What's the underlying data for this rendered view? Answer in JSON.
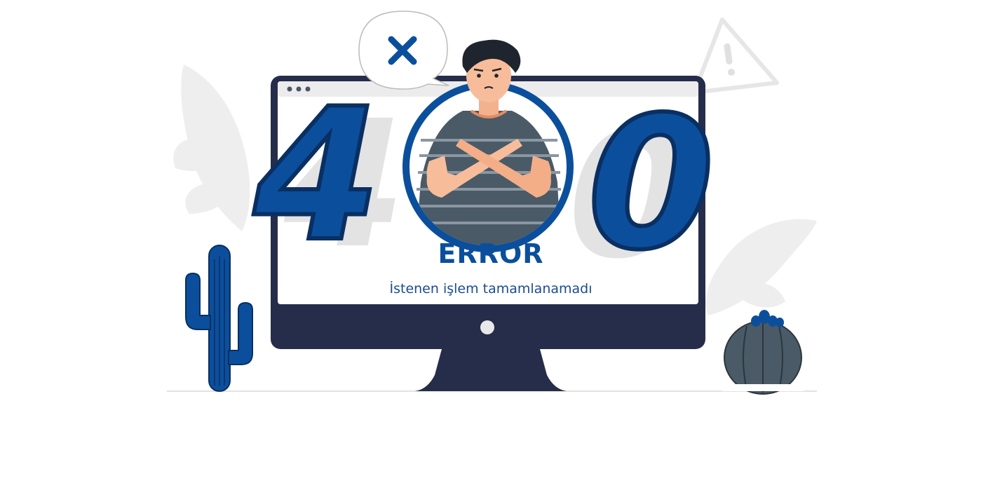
{
  "error": {
    "code_digits": [
      "4",
      "0",
      "0"
    ],
    "title": "ERROR",
    "message": "İstenen işlem tamamlanamadı"
  },
  "icons": {
    "speech": "close-x-icon",
    "warning": "warning-triangle-icon",
    "window_dots": "window-dots-icon"
  },
  "colors": {
    "brand_blue": "#0b4f9c",
    "dark_blue": "#0a2f62",
    "monitor_navy": "#252d4a",
    "shirt_gray": "#4a5a66",
    "light_gray": "#ececec"
  }
}
